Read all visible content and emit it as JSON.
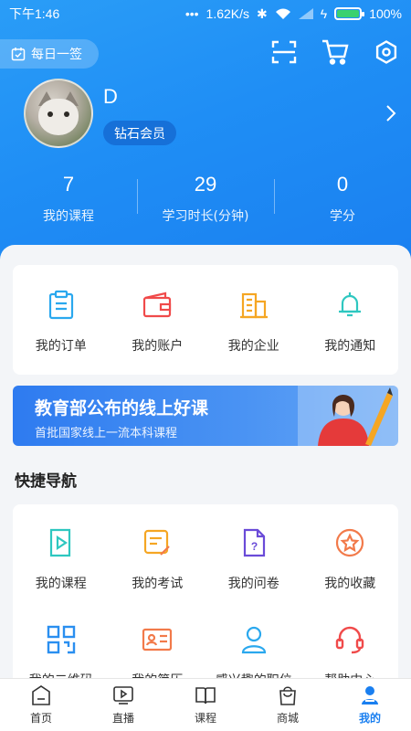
{
  "status": {
    "time": "下午1:46",
    "speed": "1.62K/s",
    "battery": "100%",
    "battery_level": 1.0
  },
  "header": {
    "checkin_label": "每日一签",
    "username": "D",
    "member_badge": "钻石会员",
    "icons": [
      "scan-icon",
      "cart-icon",
      "settings-icon"
    ]
  },
  "stats": [
    {
      "value": "7",
      "label": "我的课程"
    },
    {
      "value": "29",
      "label": "学习时长(分钟)"
    },
    {
      "value": "0",
      "label": "学分"
    }
  ],
  "account_grid": [
    {
      "label": "我的订单",
      "icon": "order-icon",
      "color": "#2aa8ee"
    },
    {
      "label": "我的账户",
      "icon": "wallet-icon",
      "color": "#f04a4a"
    },
    {
      "label": "我的企业",
      "icon": "building-icon",
      "color": "#f5a623"
    },
    {
      "label": "我的通知",
      "icon": "bell-icon",
      "color": "#2ec7c0"
    }
  ],
  "banner": {
    "title": "教育部公布的线上好课",
    "subtitle": "首批国家线上一流本科课程"
  },
  "quick_nav": {
    "title": "快捷导航",
    "items": [
      {
        "label": "我的课程",
        "icon": "play-book-icon",
        "color": "#2ec7c0"
      },
      {
        "label": "我的考试",
        "icon": "exam-icon",
        "color": "#f5a623"
      },
      {
        "label": "我的问卷",
        "icon": "questionnaire-icon",
        "color": "#6a4bd8"
      },
      {
        "label": "我的收藏",
        "icon": "star-icon",
        "color": "#f27a4a"
      },
      {
        "label": "我的二维码",
        "icon": "qrcode-icon",
        "color": "#2a8ff0"
      },
      {
        "label": "我的简历",
        "icon": "resume-icon",
        "color": "#f27a4a"
      },
      {
        "label": "感兴趣的职位",
        "icon": "position-icon",
        "color": "#2aa8ee"
      },
      {
        "label": "帮助中心",
        "icon": "headset-icon",
        "color": "#f04a4a"
      }
    ]
  },
  "tabbar": [
    {
      "label": "首页",
      "icon": "home-icon",
      "active": false
    },
    {
      "label": "直播",
      "icon": "live-icon",
      "active": false
    },
    {
      "label": "课程",
      "icon": "course-icon",
      "active": false
    },
    {
      "label": "商城",
      "icon": "shop-icon",
      "active": false
    },
    {
      "label": "我的",
      "icon": "profile-icon",
      "active": true
    }
  ],
  "colors": {
    "primary": "#1a7ff0",
    "header_gradient_start": "#2a9df7"
  }
}
